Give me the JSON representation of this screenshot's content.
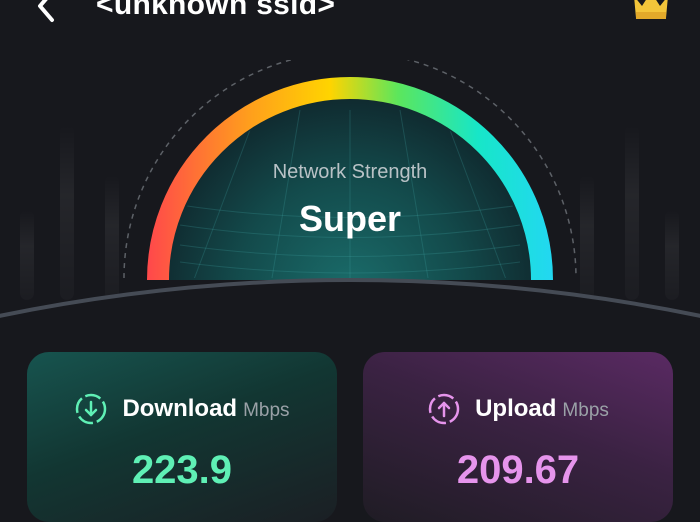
{
  "header": {
    "title": "<unknown ssid>",
    "back_icon": "chevron-left-icon",
    "premium_icon": "crown-icon"
  },
  "gauge": {
    "label": "Network Strength",
    "value": "Super",
    "colors": [
      "#ff4a4a",
      "#ff9f1c",
      "#ffd400",
      "#5ce65c",
      "#17e6c8",
      "#22d8f0"
    ]
  },
  "download": {
    "title": "Download",
    "unit": "Mbps",
    "value": "223.9",
    "icon": "download-icon",
    "accent": "#5ff0b5"
  },
  "upload": {
    "title": "Upload",
    "unit": "Mbps",
    "value": "209.67",
    "icon": "upload-icon",
    "accent": "#e694ec"
  }
}
